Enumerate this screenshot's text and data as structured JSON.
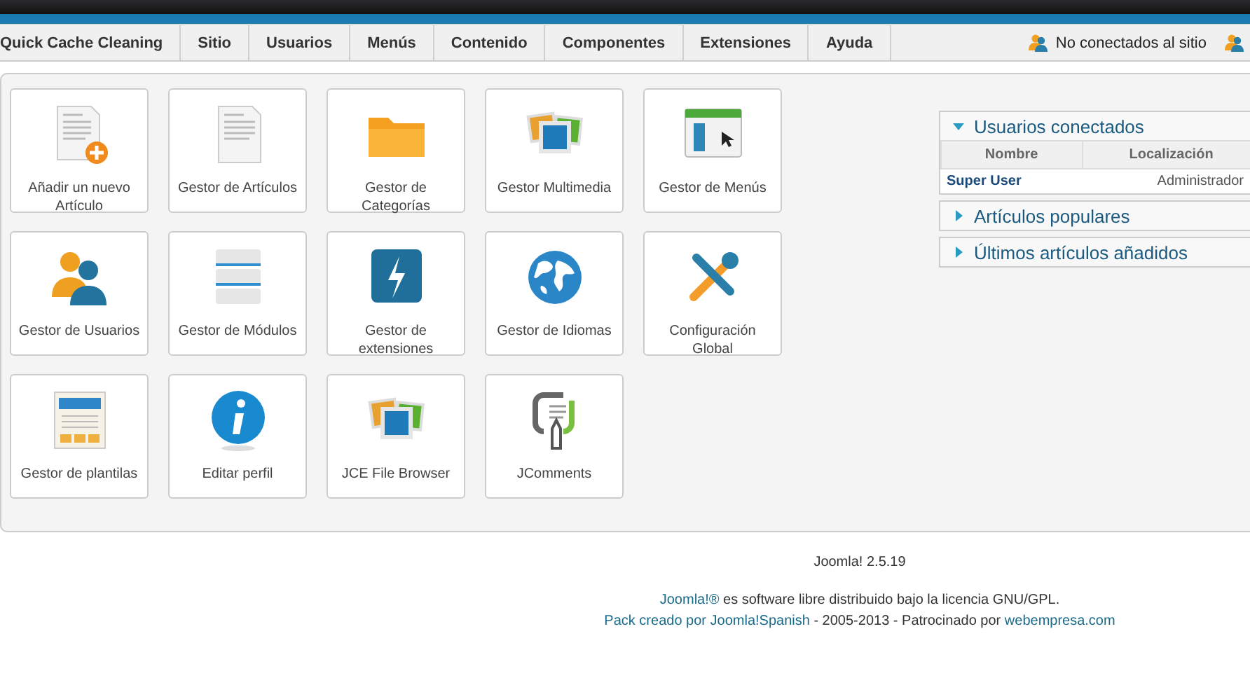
{
  "menu": {
    "items": [
      {
        "label": "Quick Cache Cleaning"
      },
      {
        "label": "Sitio"
      },
      {
        "label": "Usuarios"
      },
      {
        "label": "Menús"
      },
      {
        "label": "Contenido"
      },
      {
        "label": "Componentes"
      },
      {
        "label": "Extensiones"
      },
      {
        "label": "Ayuda"
      }
    ],
    "status": "No conectados al sitio"
  },
  "tiles": [
    {
      "label": "Añadir un nuevo Artículo"
    },
    {
      "label": "Gestor de Artículos"
    },
    {
      "label": "Gestor de Categorías"
    },
    {
      "label": "Gestor Multimedia"
    },
    {
      "label": "Gestor de Menús"
    },
    {
      "label": "Gestor de Usuarios"
    },
    {
      "label": "Gestor de Módulos"
    },
    {
      "label": "Gestor de extensiones"
    },
    {
      "label": "Gestor de Idiomas"
    },
    {
      "label": "Configuración Global"
    },
    {
      "label": "Gestor de plantilas"
    },
    {
      "label": "Editar perfil"
    },
    {
      "label": "JCE File Browser"
    },
    {
      "label": "JComments"
    }
  ],
  "modules": [
    {
      "title": "Usuarios conectados",
      "expanded": true,
      "columns": [
        "Nombre",
        "Localización"
      ],
      "rows": [
        [
          "Super User",
          "Administrador"
        ]
      ]
    },
    {
      "title": "Artículos populares",
      "expanded": false
    },
    {
      "title": "Últimos artículos añadidos",
      "expanded": false
    }
  ],
  "footer": {
    "version": "Joomla! 2.5.19",
    "lines": [
      [
        {
          "text": "Joomla!®",
          "link": true
        },
        {
          "text": " es software libre distribuido bajo la licencia GNU/GPL.",
          "link": false
        }
      ],
      [
        {
          "text": "Pack creado por Joomla!Spanish",
          "link": true
        },
        {
          "text": " - 2005-2013 - Patrocinado por ",
          "link": false
        },
        {
          "text": "webempresa.com",
          "link": true
        }
      ]
    ]
  }
}
